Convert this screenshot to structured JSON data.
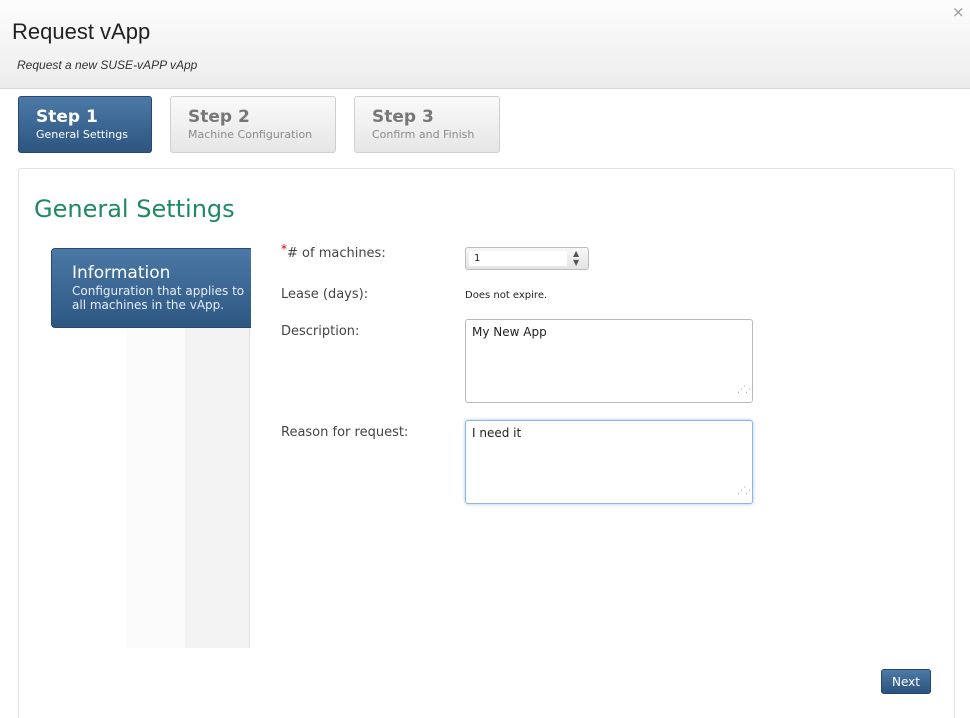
{
  "dialog": {
    "title": "Request vApp",
    "subtitle": "Request a new SUSE-vAPP vApp",
    "close_glyph": "×"
  },
  "steps": [
    {
      "number": "Step 1",
      "label": "General Settings",
      "active": true
    },
    {
      "number": "Step 2",
      "label": "Machine Configuration",
      "active": false
    },
    {
      "number": "Step 3",
      "label": "Confirm and Finish",
      "active": false
    }
  ],
  "section": {
    "title": "General Settings"
  },
  "info_tab": {
    "title": "Information",
    "description": "Configuration that applies to all machines in the vApp."
  },
  "form": {
    "required_marker": "*",
    "machines_label": "# of machines:",
    "machines_value": "1",
    "lease_label": "Lease (days):",
    "lease_value": "Does not expire.",
    "description_label": "Description:",
    "description_value": "My New App",
    "reason_label": "Reason for request:",
    "reason_value": "I need it"
  },
  "buttons": {
    "next_label": "Next"
  },
  "icons": {
    "close": "close-icon",
    "spin_up": "chevron-up-icon",
    "spin_down": "chevron-down-icon",
    "resize": "resize-grip-icon"
  },
  "colors": {
    "accent_blue": "#2d5580",
    "section_title": "#1f8a62",
    "required": "#d40000"
  }
}
